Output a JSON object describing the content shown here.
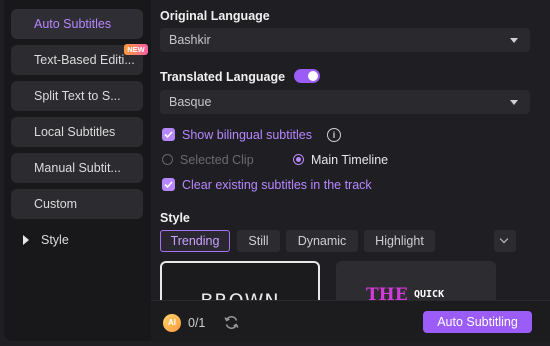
{
  "sidebar": {
    "items": [
      {
        "label": "Auto Subtitles"
      },
      {
        "label": "Text-Based Editi..."
      },
      {
        "label": "Split Text to S..."
      },
      {
        "label": "Local Subtitles"
      },
      {
        "label": "Manual Subtit..."
      },
      {
        "label": "Custom"
      },
      {
        "label": "Style"
      }
    ],
    "new_badge": "NEW"
  },
  "original_language": {
    "label": "Original Language",
    "value": "Bashkir"
  },
  "translated_language": {
    "label": "Translated Language",
    "value": "Basque",
    "enabled": true
  },
  "options": {
    "bilingual_label": "Show bilingual subtitles",
    "info_glyph": "i",
    "selected_clip_label": "Selected Clip",
    "main_timeline_label": "Main Timeline",
    "clear_existing_label": "Clear existing subtitles in the track"
  },
  "style": {
    "label": "Style",
    "tabs": [
      "Trending",
      "Still",
      "Dynamic",
      "Highlight"
    ],
    "active_tab": "Trending",
    "preview1_text": "BROWN",
    "preview2_big": "THE",
    "preview2_small": "QUICK"
  },
  "footer": {
    "ai_label": "AI",
    "credit": "0/1",
    "button_label": "Auto Subtitling"
  },
  "colors": {
    "accent": "#9b5cf7",
    "accent_text": "#b787ff"
  }
}
